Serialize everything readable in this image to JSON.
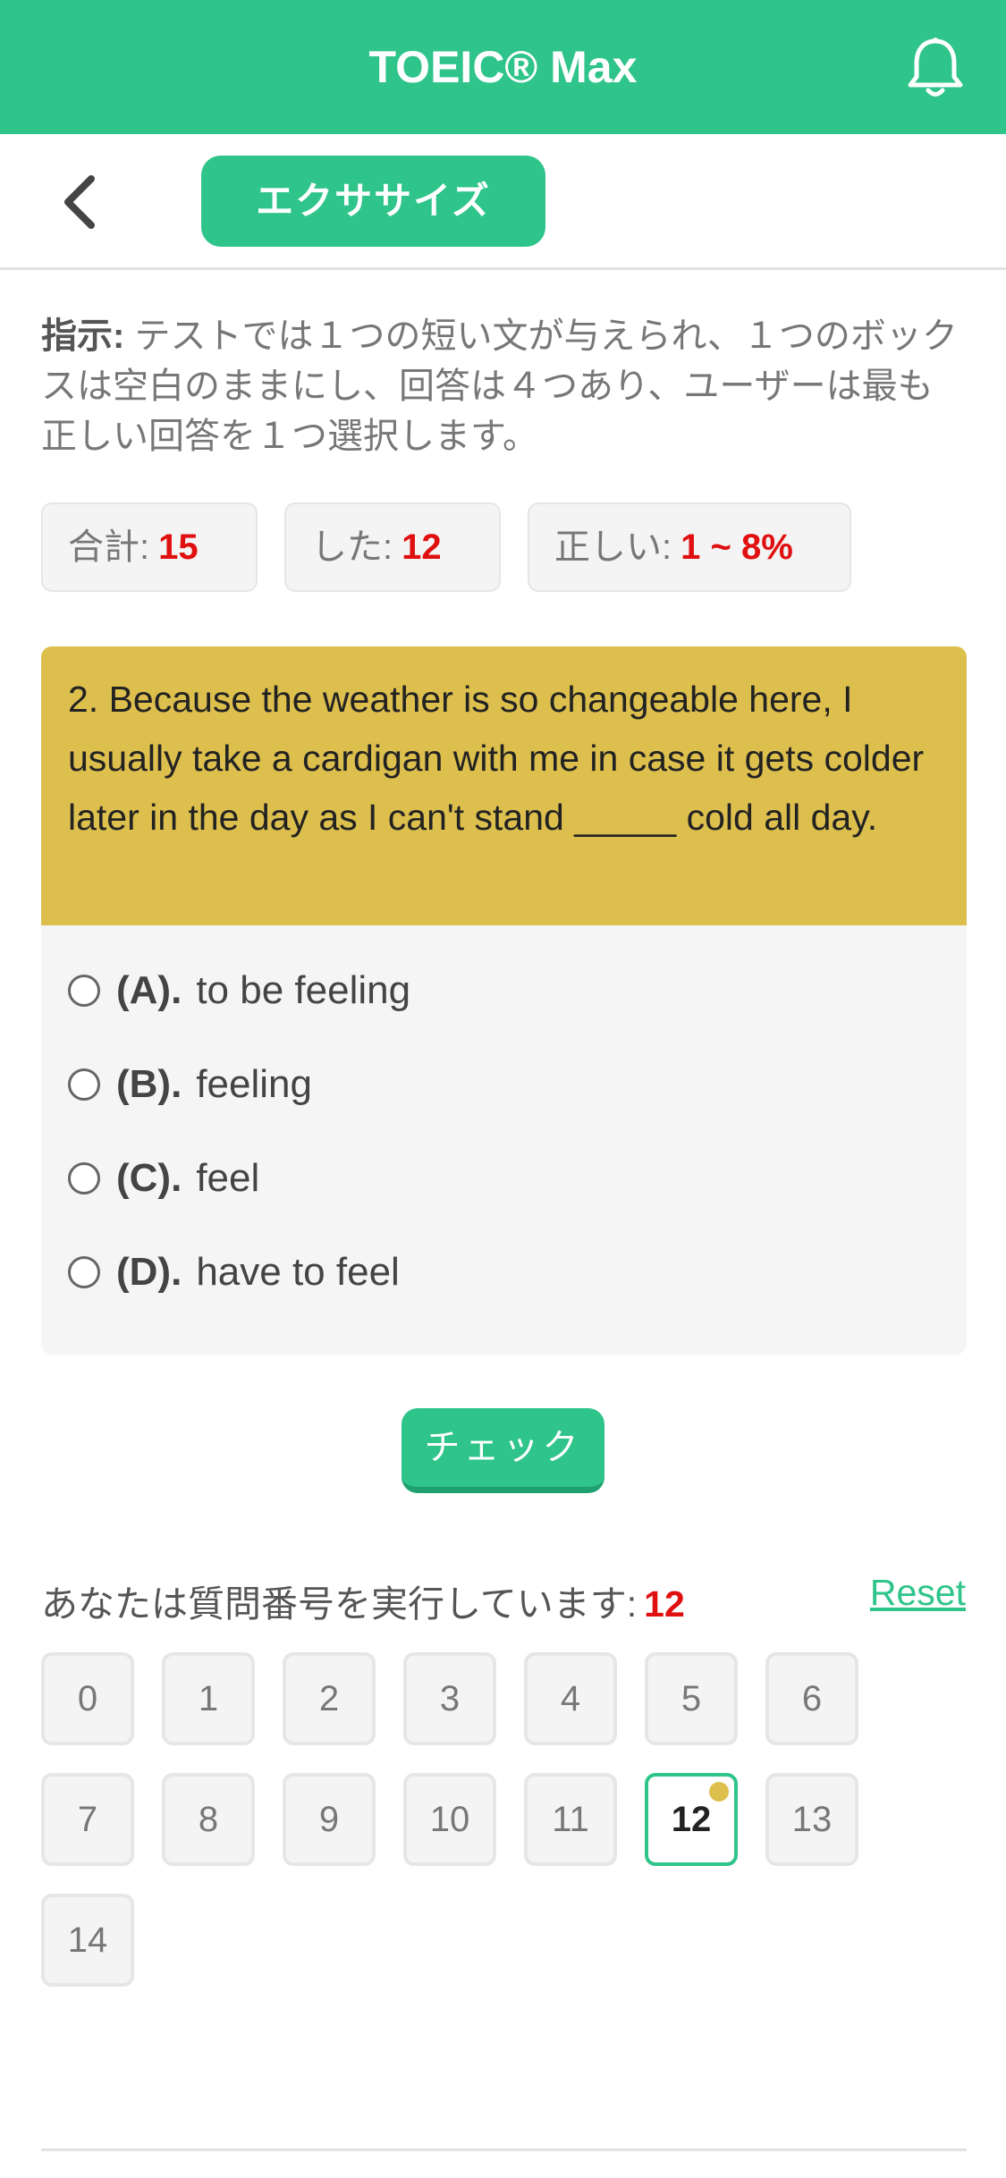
{
  "app": {
    "title": "TOEIC® Max"
  },
  "subbar": {
    "tab_label": "エクササイズ"
  },
  "instructions": {
    "label": "指示:",
    "text": " テストでは１つの短い文が与えられ、１つのボックスは空白のままにし、回答は４つあり、ユーザーは最も正しい回答を１つ選択します。"
  },
  "stats": {
    "total_label": "合計:",
    "total_value": "15",
    "done_label": "した:",
    "done_value": "12",
    "correct_label": "正しい:",
    "correct_value": "1 ~ 8%"
  },
  "question": {
    "text": "2. Because the weather is so changeable here, I usually take a cardigan with me in case it gets colder later in the day as I can't stand _____ cold all day.",
    "options": [
      {
        "letter": "(A).",
        "text": "to be feeling"
      },
      {
        "letter": "(B).",
        "text": "feeling"
      },
      {
        "letter": "(C).",
        "text": "feel"
      },
      {
        "letter": "(D).",
        "text": "have to feel"
      }
    ]
  },
  "check_button": "チェック",
  "progress": {
    "label": "あなたは質問番号を実行しています:",
    "current": "12",
    "reset_label": "Reset",
    "numbers": [
      "0",
      "1",
      "2",
      "3",
      "4",
      "5",
      "6",
      "7",
      "8",
      "9",
      "10",
      "11",
      "12",
      "13",
      "14"
    ],
    "active_index": 12
  },
  "colors": {
    "brand": "#2ec48a",
    "question_bg": "#ddbf4e",
    "accent_red": "#e01010"
  }
}
